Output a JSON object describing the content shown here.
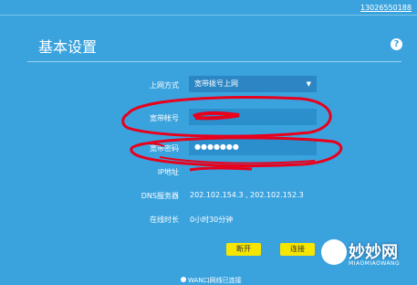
{
  "header": {
    "phone": "13026550188",
    "title": "基本设置",
    "help_icon_text": "?"
  },
  "form": {
    "mode_label": "上网方式",
    "mode_value": "宽带拨号上网",
    "account_label": "宽带帐号",
    "password_label": "宽带密码",
    "password_mask": "●●●●●●●",
    "ip_label": "IP地址",
    "dns_label": "DNS服务器",
    "dns_value": "202.102.154.3 , 202.102.152.3",
    "online_label": "在线时长",
    "online_value": "0小时30分钟"
  },
  "buttons": {
    "disconnect": "断开",
    "connect": "连接"
  },
  "footer": {
    "wan_text": "WAN口网线已连接"
  },
  "watermark": {
    "brand": "妙妙网",
    "sub": "MIAOMIAOWANG"
  },
  "colors": {
    "background": "#3aa3de",
    "field": "#2a8fcc",
    "button": "#f6e500",
    "annotation": "#e8001c"
  }
}
